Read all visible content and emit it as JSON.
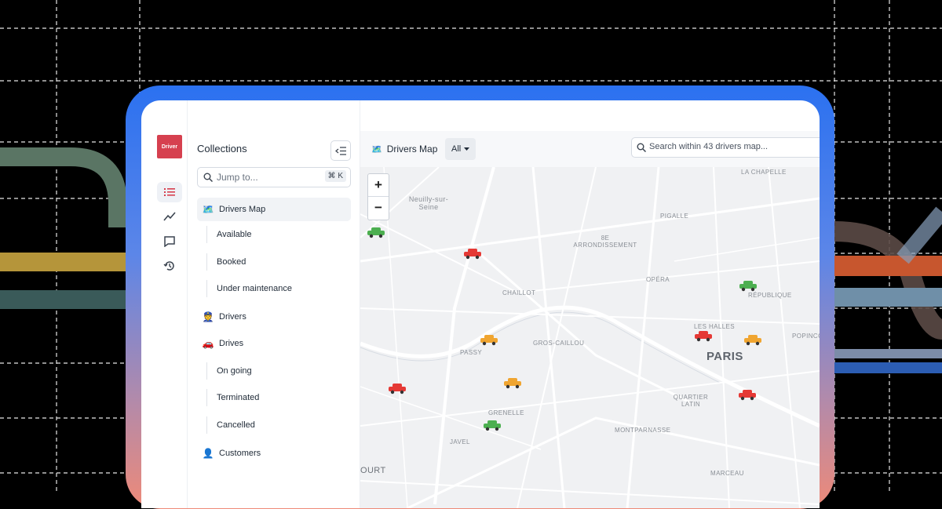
{
  "app": {
    "logo_text": "Driver"
  },
  "rail": {
    "icons": [
      "list-icon",
      "chart-icon",
      "chat-icon",
      "history-icon"
    ]
  },
  "sidebar": {
    "title": "Collections",
    "search_placeholder": "Jump to...",
    "search_shortcut": "⌘ K",
    "items": [
      {
        "label": "Drivers Map",
        "icon": "map-icon"
      },
      {
        "label": "Available"
      },
      {
        "label": "Booked"
      },
      {
        "label": "Under maintenance"
      },
      {
        "label": "Drivers",
        "icon": "police-officer-icon"
      },
      {
        "label": "Drives",
        "icon": "car-icon"
      },
      {
        "label": "On going"
      },
      {
        "label": "Terminated"
      },
      {
        "label": "Cancelled"
      },
      {
        "label": "Customers",
        "icon": "person-icon"
      }
    ]
  },
  "main": {
    "view_title": "Drivers Map",
    "filter_label": "All",
    "search_placeholder": "Search within 43 drivers map..."
  },
  "map": {
    "zoom_in": "+",
    "zoom_out": "−",
    "labels": [
      "Neuilly-sur-Seine",
      "LA CHAPELLE",
      "PIGALLE",
      "8E ARRONDISSEMENT",
      "OPÉRA",
      "RÉPUBLIQUE",
      "CHAILLOT",
      "LES HALLES",
      "POPINCO",
      "GROS-CAILLOU",
      "PASSY",
      "PARIS",
      "QUARTIER LATIN",
      "GRENELLE",
      "MONTPARNASSE",
      "JAVEL",
      "OURT",
      "MARCEAU"
    ],
    "colors": {
      "available": "#4caf50",
      "booked": "#e53935",
      "maintenance": "#f0a530"
    }
  }
}
